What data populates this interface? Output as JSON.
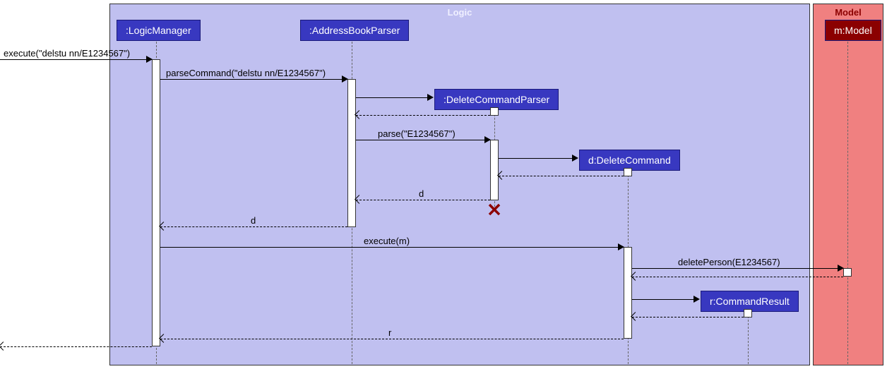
{
  "boxes": {
    "logic": {
      "title": "Logic"
    },
    "model": {
      "title": "Model"
    }
  },
  "participants": {
    "logicManager": {
      "label": ":LogicManager"
    },
    "addressBookParser": {
      "label": ":AddressBookParser"
    },
    "deleteCommandParser": {
      "label": ":DeleteCommandParser"
    },
    "deleteCommand": {
      "label": "d:DeleteCommand"
    },
    "commandResult": {
      "label": "r:CommandResult"
    },
    "model": {
      "label": "m:Model"
    }
  },
  "messages": {
    "m1": {
      "label": "execute(\"delstu nn/E1234567\")"
    },
    "m2": {
      "label": "parseCommand(\"delstu nn/E1234567\")"
    },
    "m3": {
      "label": "parse(\"E1234567\")"
    },
    "m4": {
      "label": "d"
    },
    "m5": {
      "label": "d"
    },
    "m6": {
      "label": "execute(m)"
    },
    "m7": {
      "label": "deletePerson(E1234567)"
    },
    "m8": {
      "label": "r"
    }
  }
}
